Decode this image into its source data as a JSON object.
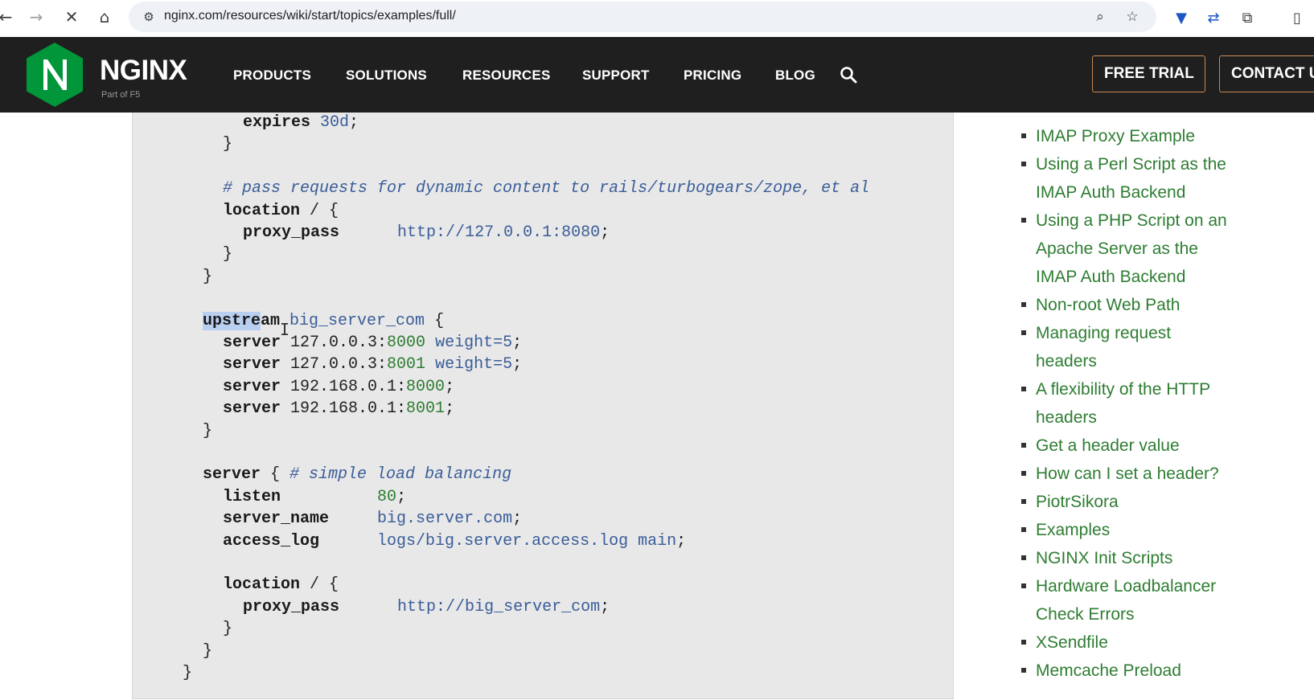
{
  "browser": {
    "url": "nginx.com/resources/wiki/start/topics/examples/full/"
  },
  "nav": {
    "logo_text": "NGINX",
    "logo_sub": "Part of F5",
    "items": [
      "PRODUCTS",
      "SOLUTIONS",
      "RESOURCES",
      "SUPPORT",
      "PRICING",
      "BLOG"
    ],
    "free_trial": "FREE TRIAL",
    "contact": "CONTACT U"
  },
  "code": {
    "lines": [
      {
        "indent": 4,
        "parts": [
          {
            "t": "expires",
            "c": "kw"
          },
          {
            "t": " "
          },
          {
            "t": "30d",
            "c": "val"
          },
          {
            "t": ";"
          }
        ]
      },
      {
        "indent": 3,
        "parts": [
          {
            "t": "}"
          }
        ]
      },
      {
        "indent": 0,
        "parts": []
      },
      {
        "indent": 3,
        "parts": [
          {
            "t": "# pass requests for dynamic content to rails/turbogears/zope, et al",
            "c": "cm"
          }
        ]
      },
      {
        "indent": 3,
        "parts": [
          {
            "t": "location",
            "c": "kw"
          },
          {
            "t": " / {"
          }
        ]
      },
      {
        "indent": 4,
        "parts": [
          {
            "t": "proxy_pass",
            "c": "kw"
          },
          {
            "t": "      "
          },
          {
            "t": "http://127.0.0.1:8080",
            "c": "val"
          },
          {
            "t": ";"
          }
        ]
      },
      {
        "indent": 3,
        "parts": [
          {
            "t": "}"
          }
        ]
      },
      {
        "indent": 2,
        "parts": [
          {
            "t": "}"
          }
        ]
      },
      {
        "indent": 0,
        "parts": []
      },
      {
        "indent": 2,
        "parts": [
          {
            "t": "upstre",
            "c": "kw sel"
          },
          {
            "t": "am",
            "c": "kw"
          },
          {
            "t": " big_server_com",
            "c": "val"
          },
          {
            "t": " {"
          }
        ]
      },
      {
        "indent": 3,
        "parts": [
          {
            "t": "server",
            "c": "kw"
          },
          {
            "t": " 127.0.0.3:"
          },
          {
            "t": "8000",
            "c": "num"
          },
          {
            "t": " weight=5",
            "c": "val"
          },
          {
            "t": ";"
          }
        ]
      },
      {
        "indent": 3,
        "parts": [
          {
            "t": "server",
            "c": "kw"
          },
          {
            "t": " 127.0.0.3:"
          },
          {
            "t": "8001",
            "c": "num"
          },
          {
            "t": " weight=5",
            "c": "val"
          },
          {
            "t": ";"
          }
        ]
      },
      {
        "indent": 3,
        "parts": [
          {
            "t": "server",
            "c": "kw"
          },
          {
            "t": " 192.168.0.1:"
          },
          {
            "t": "8000",
            "c": "num"
          },
          {
            "t": ";"
          }
        ]
      },
      {
        "indent": 3,
        "parts": [
          {
            "t": "server",
            "c": "kw"
          },
          {
            "t": " 192.168.0.1:"
          },
          {
            "t": "8001",
            "c": "num"
          },
          {
            "t": ";"
          }
        ]
      },
      {
        "indent": 2,
        "parts": [
          {
            "t": "}"
          }
        ]
      },
      {
        "indent": 0,
        "parts": []
      },
      {
        "indent": 2,
        "parts": [
          {
            "t": "server",
            "c": "kw"
          },
          {
            "t": " { "
          },
          {
            "t": "# simple load balancing",
            "c": "cm"
          }
        ]
      },
      {
        "indent": 3,
        "parts": [
          {
            "t": "listen",
            "c": "kw"
          },
          {
            "t": "          "
          },
          {
            "t": "80",
            "c": "num"
          },
          {
            "t": ";"
          }
        ]
      },
      {
        "indent": 3,
        "parts": [
          {
            "t": "server_name",
            "c": "kw"
          },
          {
            "t": "     "
          },
          {
            "t": "big.server.com",
            "c": "val"
          },
          {
            "t": ";"
          }
        ]
      },
      {
        "indent": 3,
        "parts": [
          {
            "t": "access_log",
            "c": "kw"
          },
          {
            "t": "      "
          },
          {
            "t": "logs/big.server.access.log main",
            "c": "val"
          },
          {
            "t": ";"
          }
        ]
      },
      {
        "indent": 0,
        "parts": []
      },
      {
        "indent": 3,
        "parts": [
          {
            "t": "location",
            "c": "kw"
          },
          {
            "t": " / {"
          }
        ]
      },
      {
        "indent": 4,
        "parts": [
          {
            "t": "proxy_pass",
            "c": "kw"
          },
          {
            "t": "      "
          },
          {
            "t": "http://big_server_com",
            "c": "val"
          },
          {
            "t": ";"
          }
        ]
      },
      {
        "indent": 3,
        "parts": [
          {
            "t": "}"
          }
        ]
      },
      {
        "indent": 2,
        "parts": [
          {
            "t": "}"
          }
        ]
      },
      {
        "indent": 1,
        "parts": [
          {
            "t": "}"
          }
        ]
      }
    ]
  },
  "sidebar": {
    "items": [
      "IMAP Proxy Example",
      "Using a Perl Script as the\nIMAP Auth Backend",
      "Using a PHP Script on an\nApache Server as the\nIMAP Auth Backend",
      "Non-root Web Path",
      "Managing request\nheaders",
      "A flexibility of the HTTP\nheaders",
      "Get a header value",
      "How can I set a header?",
      "PiotrSikora",
      "Examples",
      "NGINX Init Scripts",
      "Hardware Loadbalancer\nCheck Errors",
      "XSendfile",
      "Memcache Preload"
    ]
  },
  "colors": {
    "nav_bg": "#1f1f1f",
    "brand_green": "#009639",
    "link_green": "#2e7d32",
    "cta_border": "#c98a52",
    "code_bg": "#e8e8e8"
  }
}
